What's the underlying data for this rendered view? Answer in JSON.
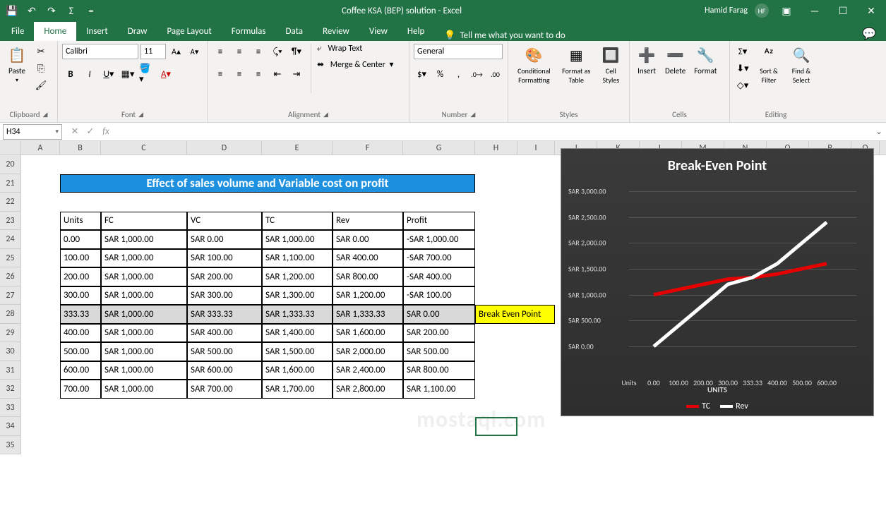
{
  "app": {
    "title": "Coffee KSA (BEP) solution - Excel",
    "user": "Hamid Farag",
    "initials": "HF"
  },
  "qat": {
    "save": "💾",
    "undo": "↶",
    "redo": "↷",
    "autosum": "Σ",
    "more": "="
  },
  "tabs": {
    "file": "File",
    "home": "Home",
    "insert": "Insert",
    "draw": "Draw",
    "page_layout": "Page Layout",
    "formulas": "Formulas",
    "data": "Data",
    "review": "Review",
    "view": "View",
    "help": "Help",
    "tell_me": "Tell me what you want to do"
  },
  "ribbon": {
    "clipboard": {
      "label": "Clipboard",
      "paste": "Paste"
    },
    "font": {
      "label": "Font",
      "name": "Calibri",
      "size": "11"
    },
    "alignment": {
      "label": "Alignment",
      "wrap": "Wrap Text",
      "merge": "Merge & Center"
    },
    "number": {
      "label": "Number",
      "format": "General"
    },
    "styles": {
      "label": "Styles",
      "cond": "Conditional Formatting",
      "table": "Format as Table",
      "cell": "Cell Styles"
    },
    "cells": {
      "label": "Cells",
      "insert": "Insert",
      "delete": "Delete",
      "format": "Format"
    },
    "editing": {
      "label": "Editing",
      "sort": "Sort & Filter",
      "find": "Find & Select"
    }
  },
  "name_box": "H34",
  "columns": [
    "A",
    "B",
    "C",
    "D",
    "E",
    "F",
    "G",
    "H",
    "I",
    "J",
    "K",
    "L",
    "M",
    "N",
    "O",
    "P",
    "Q"
  ],
  "rows": [
    "20",
    "21",
    "22",
    "23",
    "24",
    "25",
    "26",
    "27",
    "28",
    "29",
    "30",
    "31",
    "32",
    "33",
    "34",
    "35"
  ],
  "sheet": {
    "title": "Effect of sales volume and Variable cost on profit",
    "headers": [
      "Units",
      "FC",
      "VC",
      "TC",
      "Rev",
      "Profit"
    ],
    "data": [
      [
        "0.00",
        "SAR 1,000.00",
        "SAR 0.00",
        "SAR 1,000.00",
        "SAR 0.00",
        "-SAR 1,000.00"
      ],
      [
        "100.00",
        "SAR 1,000.00",
        "SAR 100.00",
        "SAR 1,100.00",
        "SAR 400.00",
        "-SAR 700.00"
      ],
      [
        "200.00",
        "SAR 1,000.00",
        "SAR 200.00",
        "SAR 1,200.00",
        "SAR 800.00",
        "-SAR 400.00"
      ],
      [
        "300.00",
        "SAR 1,000.00",
        "SAR 300.00",
        "SAR 1,300.00",
        "SAR 1,200.00",
        "-SAR 100.00"
      ],
      [
        "333.33",
        "SAR 1,000.00",
        "SAR 333.33",
        "SAR 1,333.33",
        "SAR 1,333.33",
        "SAR 0.00"
      ],
      [
        "400.00",
        "SAR 1,000.00",
        "SAR 400.00",
        "SAR 1,400.00",
        "SAR 1,600.00",
        "SAR 200.00"
      ],
      [
        "500.00",
        "SAR 1,000.00",
        "SAR 500.00",
        "SAR 1,500.00",
        "SAR 2,000.00",
        "SAR 500.00"
      ],
      [
        "600.00",
        "SAR 1,000.00",
        "SAR 600.00",
        "SAR 1,600.00",
        "SAR 2,400.00",
        "SAR 800.00"
      ],
      [
        "700.00",
        "SAR 1,000.00",
        "SAR 700.00",
        "SAR 1,700.00",
        "SAR 2,800.00",
        "SAR 1,100.00"
      ]
    ],
    "bep_label": "Break Even Point",
    "bep_row_index": 4
  },
  "chart_data": {
    "type": "line",
    "title": "Break-Even Point",
    "xlabel": "UNITS",
    "ylabel": "",
    "x_categories": [
      "Units",
      "0.00",
      "100.00",
      "200.00",
      "300.00",
      "333.33",
      "400.00",
      "500.00",
      "600.00"
    ],
    "y_ticks": [
      "SAR 0.00",
      "SAR 500.00",
      "SAR 1,000.00",
      "SAR 1,500.00",
      "SAR 2,000.00",
      "SAR 2,500.00",
      "SAR 3,000.00"
    ],
    "ylim": [
      0,
      3000
    ],
    "series": [
      {
        "name": "TC",
        "color": "#e60000",
        "values": [
          null,
          1000,
          1100,
          1200,
          1300,
          1333.33,
          1400,
          1500,
          1600
        ]
      },
      {
        "name": "Rev",
        "color": "#ffffff",
        "values": [
          null,
          0,
          400,
          800,
          1200,
          1333.33,
          1600,
          2000,
          2400
        ]
      }
    ]
  },
  "watermark": "mostaql.com"
}
